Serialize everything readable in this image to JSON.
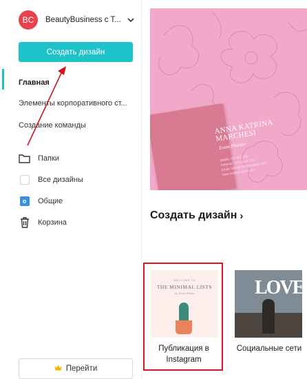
{
  "sidebar": {
    "account": {
      "initials": "BC",
      "name": "BeautyBusiness c T..."
    },
    "create_button": "Создать дизайн",
    "nav": {
      "home": "Главная",
      "brand": "Элементы корпоративного ст...",
      "team": "Создание команды"
    },
    "folders": {
      "folders_label": "Папки",
      "all_label": "Все дизайны",
      "shared_badge": "o",
      "shared_label": "Общие",
      "trash_label": "Корзина"
    },
    "go_button": "Перейти"
  },
  "main": {
    "hero_card": {
      "name": "ANNA KATRINA MARCHESI",
      "role": "Event Planner",
      "lines": [
        "Mobile: 000 000 000",
        "Address: 123 Street, City",
        "Email: hello@reallygreatsite.com",
        "www.reallygreatsite.com"
      ]
    },
    "section_title": "Создать дизайн",
    "section_arrow": "›",
    "templates": [
      {
        "label": "Публикация в Instagram",
        "thumb_small": "WELCOME TO",
        "thumb_title": "THE MINIMAL LISTS",
        "thumb_sub": "by Olivia Wilson"
      },
      {
        "label": "Социальные сети",
        "thumb_title": "LOVE"
      }
    ]
  },
  "colors": {
    "accent": "#1ec3c9",
    "avatar": "#e8434c",
    "highlight": "#e0141e",
    "hero_bg": "#f1a8c9"
  },
  "icons": [
    "chevron-down-icon",
    "folder-icon",
    "checkbox-icon",
    "shared-icon",
    "trash-icon",
    "crown-icon",
    "annotation-arrow"
  ]
}
